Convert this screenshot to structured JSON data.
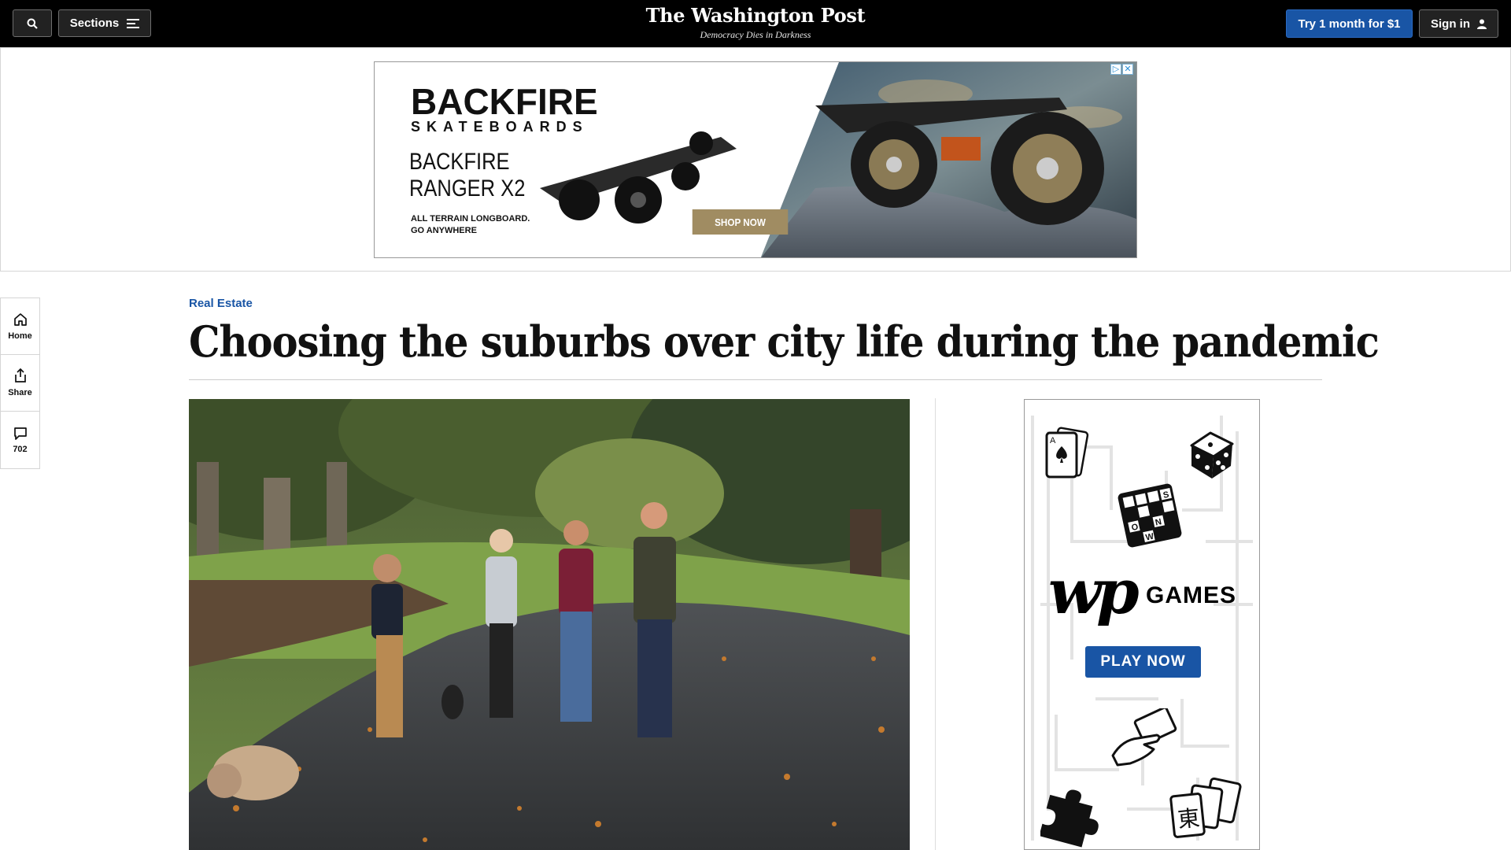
{
  "header": {
    "sections_label": "Sections",
    "logo": "The Washington Post",
    "tagline": "Democracy Dies in Darkness",
    "try_label": "Try 1 month for $1",
    "signin_label": "Sign in"
  },
  "top_ad": {
    "brand": "BACKFIRE",
    "brand_sub": "SKATEBOARDS",
    "model_line1": "BACKFIRE",
    "model_line2": "RANGER X2",
    "tag_line1": "ALL TERRAIN LONGBOARD.",
    "tag_line2": "GO ANYWHERE",
    "cta": "SHOP NOW"
  },
  "rail": {
    "home_label": "Home",
    "share_label": "Share",
    "comments_count": "702"
  },
  "article": {
    "kicker": "Real Estate",
    "headline": "Choosing the suburbs over city life during the pandemic"
  },
  "side_ad": {
    "logo": "wp",
    "word": "GAMES",
    "cta": "PLAY NOW",
    "crossword_letters": [
      "S",
      "O",
      "N",
      "W"
    ]
  },
  "colors": {
    "accent_blue": "#1955a5",
    "header_bg": "#000000"
  }
}
